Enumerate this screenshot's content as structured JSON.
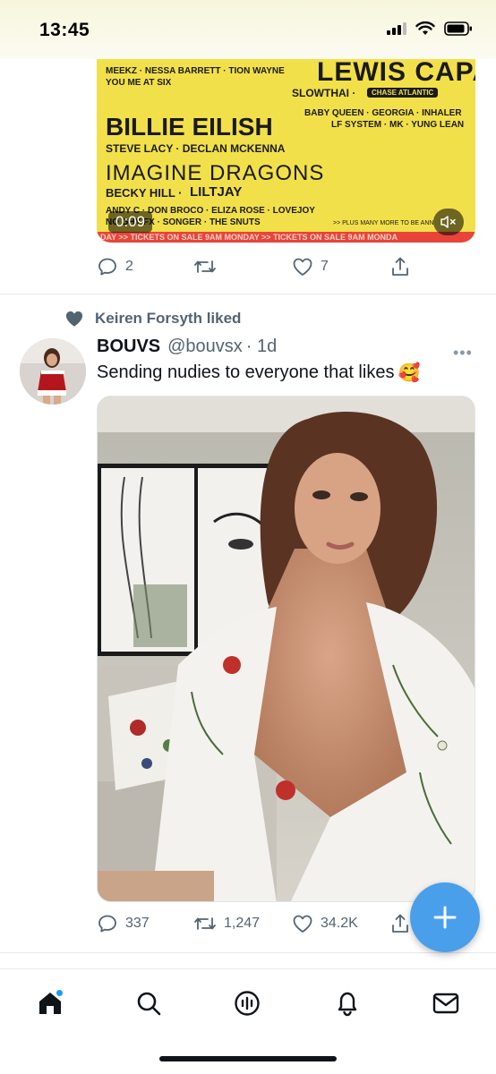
{
  "status_bar": {
    "time": "13:45"
  },
  "poster": {
    "lines": [
      "MEEKZ · NESSA BARRETT · TION WAYNE",
      "YOU ME AT SIX",
      "LEWIS CAPALDI",
      "SLOWTHAI ·",
      "CHASE ATLANTIC",
      "BABY QUEEN · GEORGIA · INHALER",
      "LF SYSTEM · MK · YUNG LEAN",
      "BILLIE EILISH",
      "STEVE LACY · DECLAN MCKENNA",
      "IMAGINE DRAGONS",
      "BECKY HILL ·",
      "LILTJAY",
      "ANDY C · DON BROCO · ELIZA ROSE · LOVEJOY",
      "NO GHY FX · SONGER · THE SNUTS",
      ">> PLUS MANY MORE TO BE ANN",
      "DAY >> TICKETS ON SALE 9AM MONDAY >> TICKETS ON SALE 9AM MONDA"
    ]
  },
  "tweet1": {
    "video_time": "0:09",
    "reply_count": "2",
    "retweet_count": "",
    "like_count": "7"
  },
  "tweet2": {
    "social_context": "Keiren Forsyth liked",
    "display_name": "BOUVS",
    "handle": "@bouvsx",
    "time": "· 1d",
    "text": "Sending nudies to everyone that likes",
    "emoji": "🥰",
    "reply_count": "337",
    "retweet_count": "1,247",
    "like_count": "34.2K"
  },
  "colors": {
    "accent": "#1d9bf0",
    "fab": "#4a9fea",
    "secondary_text": "#536471",
    "poster_yellow": "#f2e04a",
    "poster_strip": "#e8443a"
  },
  "icons": {
    "reply": "reply-icon",
    "retweet": "retweet-icon",
    "like": "heart-icon",
    "share": "share-icon",
    "compose": "compose-plus-icon",
    "mute": "muted-speaker-icon",
    "nav": [
      "home-icon",
      "search-icon",
      "spaces-icon",
      "notifications-icon",
      "messages-icon"
    ]
  }
}
